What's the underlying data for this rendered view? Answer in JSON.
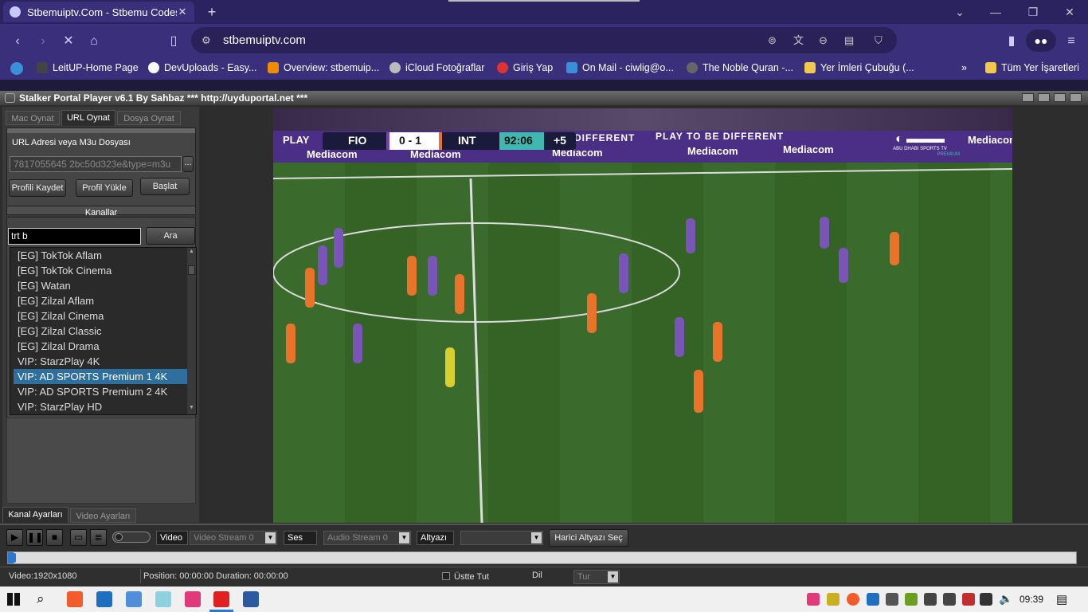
{
  "browser": {
    "tab_title": "Stbemuiptv.Com - Stbemu Codes",
    "url": "stbemuiptv.com",
    "bookmarks": [
      "LeitUP-Home Page",
      "DevUploads - Easy...",
      "Overview: stbemuip...",
      "iCloud Fotoğraflar",
      "Giriş Yap",
      "On Mail - ciwlig@o...",
      "The Noble Quran -...",
      "Yer İmleri Çubuğu (..."
    ],
    "all_bookmarks": "Tüm Yer İşaretleri",
    "more_bookmarks": "»"
  },
  "player": {
    "title": "Stalker Portal Player v6.1 By Sahbaz  *** http://uyduportal.net ***",
    "tabs": [
      "Mac Oynat",
      "URL Oynat",
      "Dosya Oynat"
    ],
    "url_label": "URL Adresi veya M3u Dosyası",
    "url_value": "7817055645 2bc50d323e&type=m3u",
    "ellipsis": "...",
    "btn_save": "Profili Kaydet",
    "btn_load": "Profil Yükle",
    "btn_start": "Başlat",
    "channels_header": "Kanallar",
    "search_value": "trt b",
    "search_btn": "Ara",
    "channels": [
      "[EG] TokTok Aflam",
      "[EG] TokTok Cinema",
      "[EG] Watan",
      "[EG] Zilzal Aflam",
      "[EG] Zilzal Cinema",
      "[EG] Zilzal Classic",
      "[EG] Zilzal Drama",
      "VIP: StarzPlay 4K",
      "VIP: AD SPORTS Premium 1 4K",
      "VIP: AD SPORTS Premium 2 4K",
      "VIP: StarzPlay  HD"
    ],
    "selected_channel_index": 8,
    "bottom_tabs": [
      "Kanal Ayarları",
      "Video Ayarları"
    ]
  },
  "scoreboard": {
    "home": "FIO",
    "score": "0 - 1",
    "away": "INT",
    "time": "92:06",
    "extra": "+5",
    "ads": [
      "PLAY",
      "DIFFERENT",
      "PLAY TO BE DIFFERENT",
      "Mediacom"
    ],
    "channel_logo": "ABU DHABI SPORTS TV",
    "channel_sub": "PREMIUM"
  },
  "controls": {
    "video_label": "Video",
    "video_stream": "Video Stream 0",
    "audio_label": "Ses",
    "audio_stream": "Audio Stream 0",
    "sub_label": "Altyazı",
    "sub_value": "",
    "external_sub": "Harici Altyazı Seç",
    "progress": 0.005
  },
  "status": {
    "resolution": "Video:1920x1080",
    "position": "Position: 00:00:00 Duration: 00:00:00",
    "ontop": "Üstte Tut",
    "lang_label": "Dil",
    "lang_value": "Tur"
  },
  "taskbar": {
    "time": "09:39"
  }
}
